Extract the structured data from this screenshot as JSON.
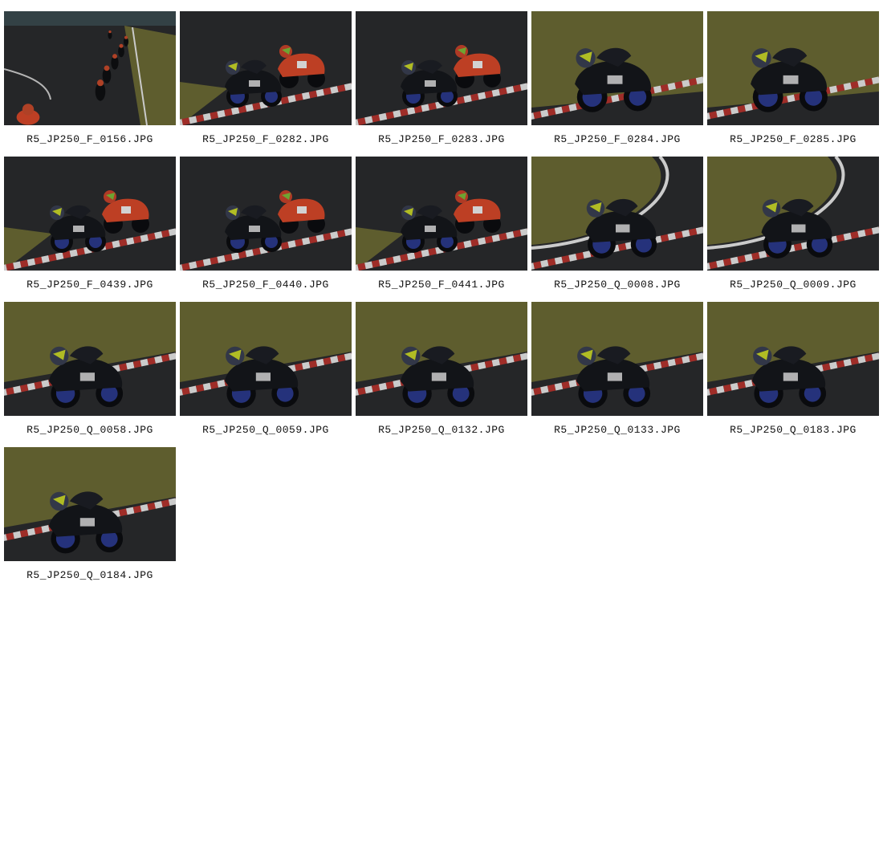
{
  "gallery": {
    "photos": [
      {
        "filename": "R5_JP250_F_0156.JPG",
        "scene": "straight"
      },
      {
        "filename": "R5_JP250_F_0282.JPG",
        "scene": "duo-track"
      },
      {
        "filename": "R5_JP250_F_0283.JPG",
        "scene": "duo-track"
      },
      {
        "filename": "R5_JP250_F_0284.JPG",
        "scene": "solo-grass"
      },
      {
        "filename": "R5_JP250_F_0285.JPG",
        "scene": "solo-grass"
      },
      {
        "filename": "R5_JP250_F_0439.JPG",
        "scene": "duo-track"
      },
      {
        "filename": "R5_JP250_F_0440.JPG",
        "scene": "duo-track"
      },
      {
        "filename": "R5_JP250_F_0441.JPG",
        "scene": "duo-track"
      },
      {
        "filename": "R5_JP250_Q_0008.JPG",
        "scene": "solo-curve"
      },
      {
        "filename": "R5_JP250_Q_0009.JPG",
        "scene": "solo-curve"
      },
      {
        "filename": "R5_JP250_Q_0058.JPG",
        "scene": "solo-kerb"
      },
      {
        "filename": "R5_JP250_Q_0059.JPG",
        "scene": "solo-kerb"
      },
      {
        "filename": "R5_JP250_Q_0132.JPG",
        "scene": "solo-kerb"
      },
      {
        "filename": "R5_JP250_Q_0133.JPG",
        "scene": "solo-kerb"
      },
      {
        "filename": "R5_JP250_Q_0183.JPG",
        "scene": "solo-kerb"
      },
      {
        "filename": "R5_JP250_Q_0184.JPG",
        "scene": "solo-kerb"
      }
    ]
  },
  "colors": {
    "asphalt": "#2b2c2e",
    "grass": "#6b6a35",
    "kerb_red": "#b5342e",
    "kerb_white": "#e8e8e8",
    "bike": "#15171c",
    "wheel": "#2b3a8c",
    "rival": "#d8482a"
  }
}
